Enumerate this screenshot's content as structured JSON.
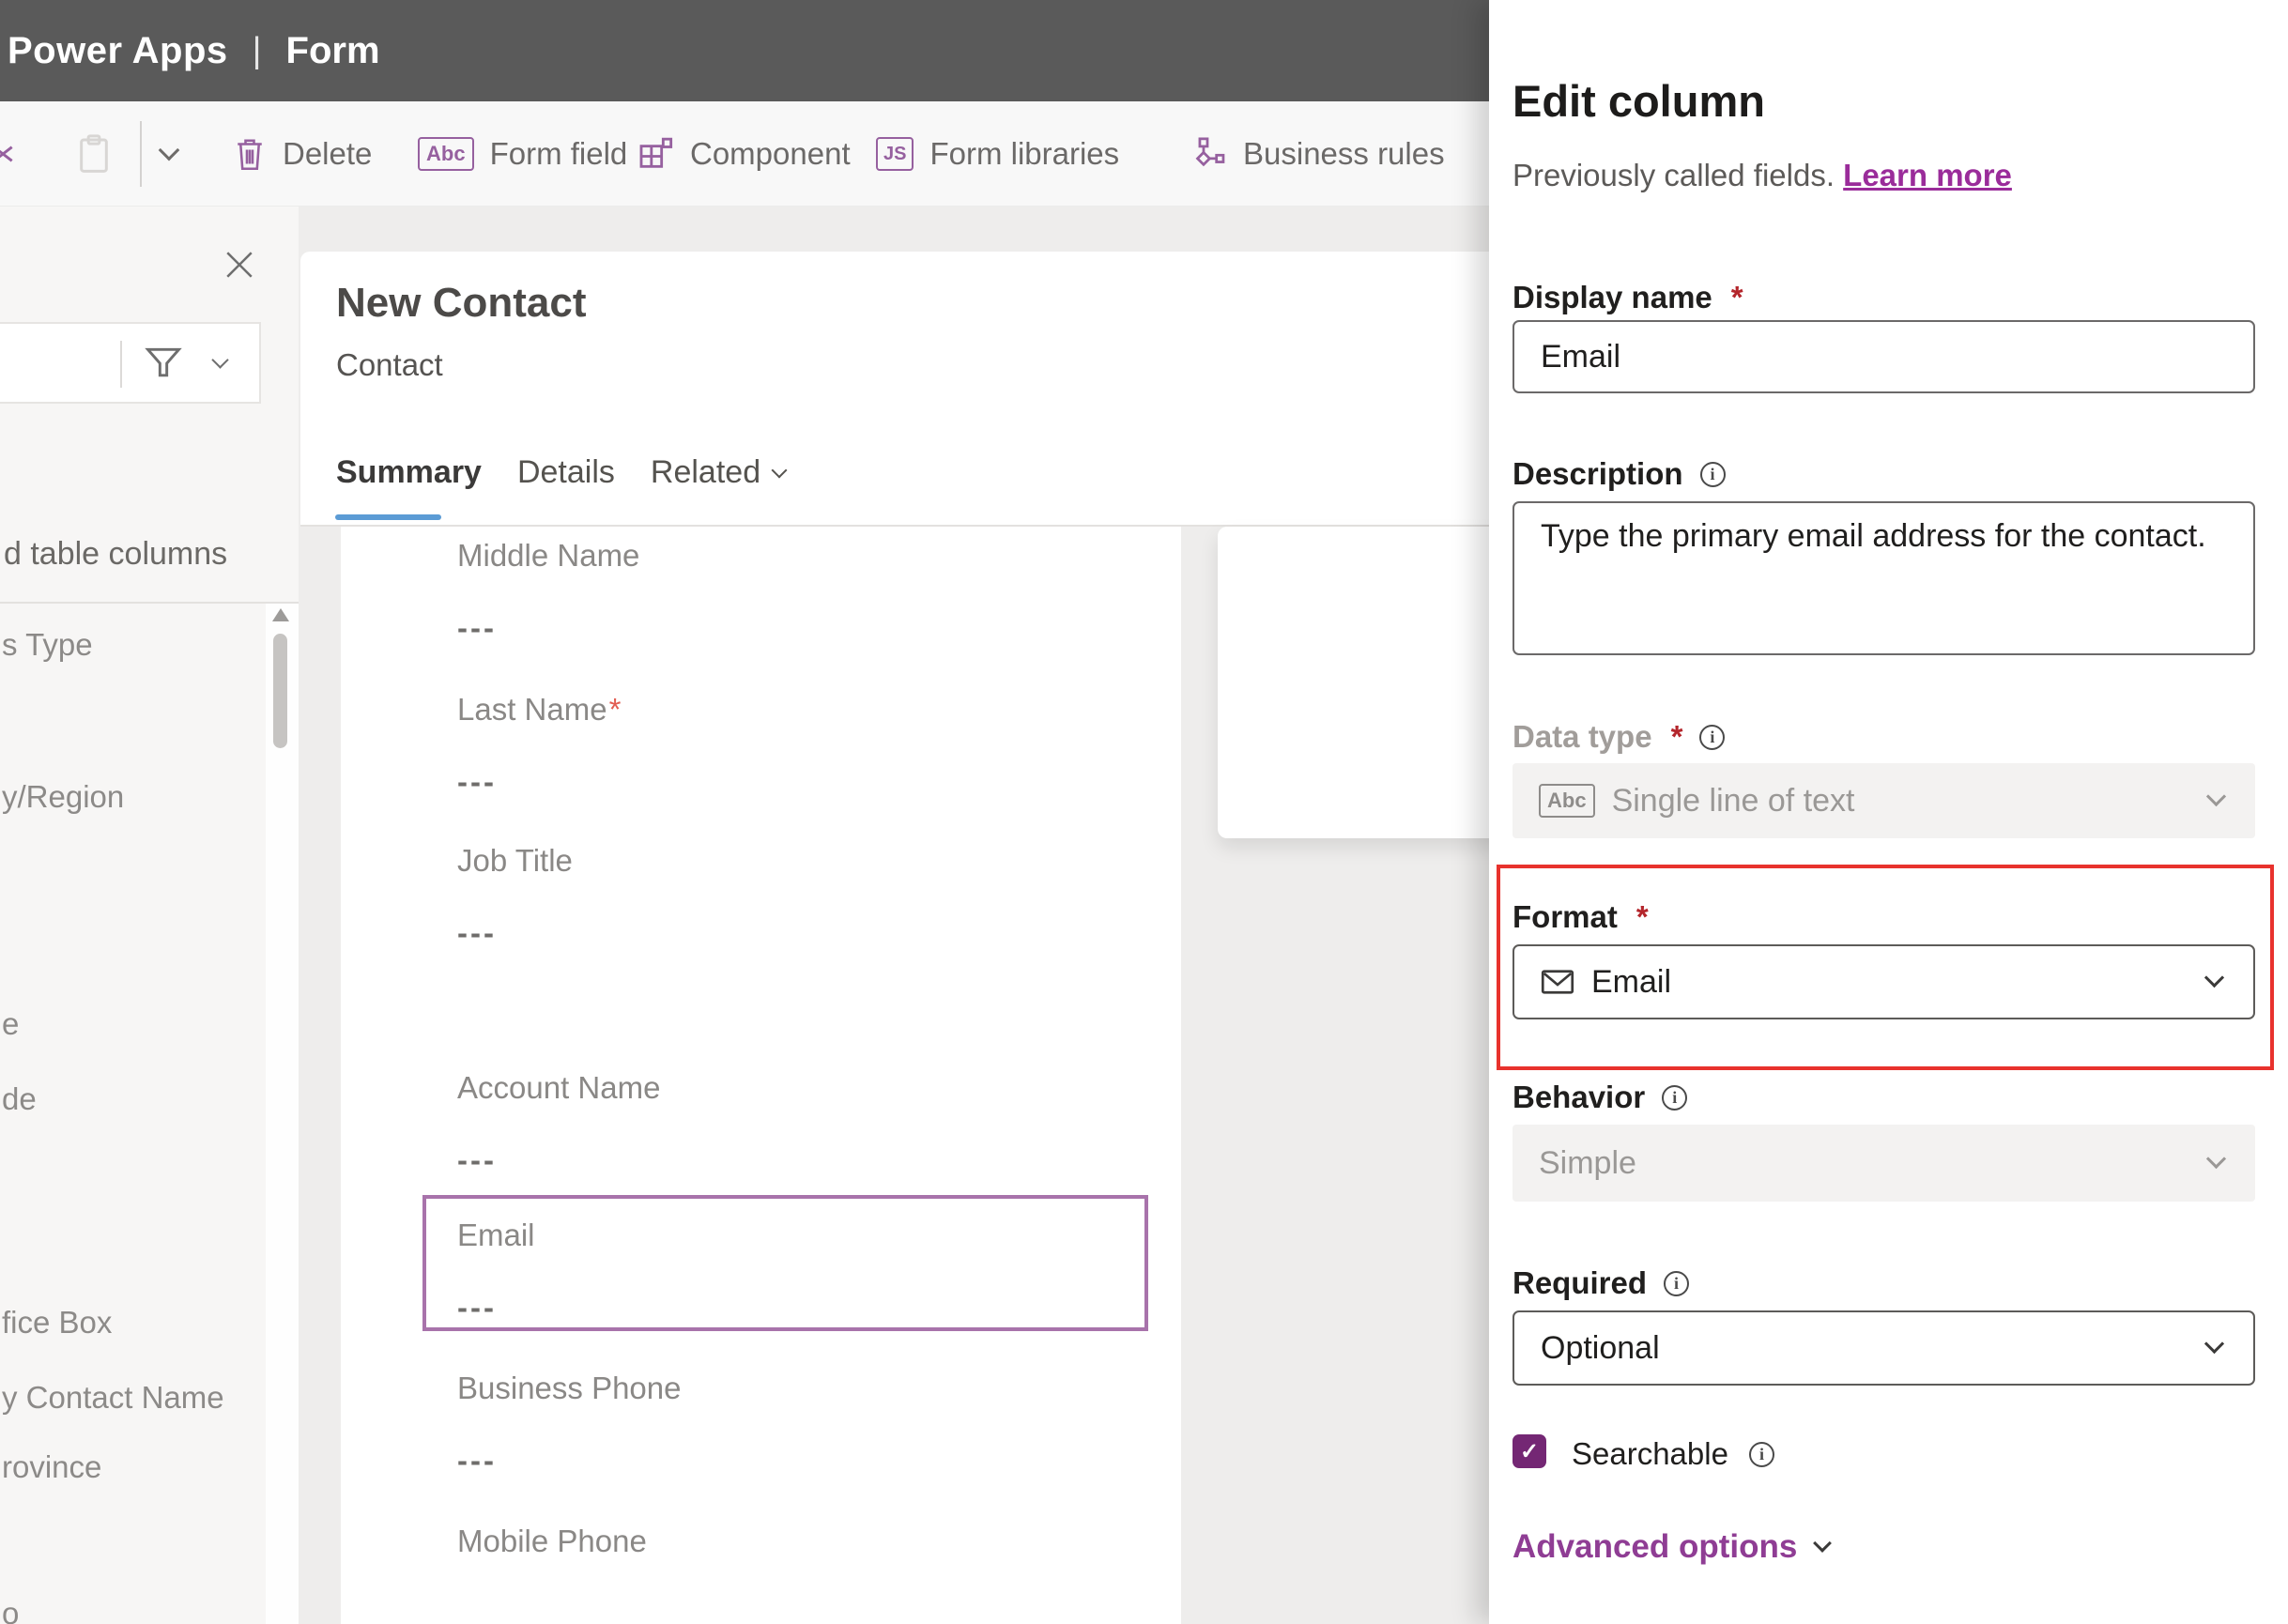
{
  "topbar": {
    "brand": "Power Apps",
    "separator": "|",
    "page": "Form"
  },
  "toolbar": {
    "items": [
      {
        "name": "delete",
        "label": "Delete"
      },
      {
        "name": "form-field",
        "label": "Form field",
        "icon_text": "Abc"
      },
      {
        "name": "component",
        "label": "Component"
      },
      {
        "name": "form-libraries",
        "label": "Form libraries",
        "icon_text": "JS"
      },
      {
        "name": "business-rules",
        "label": "Business rules"
      }
    ]
  },
  "sidebar": {
    "heading": "d table columns",
    "items": [
      "s Type",
      "y/Region",
      "e",
      "de",
      "fice Box",
      "y Contact Name",
      "rovince",
      "o"
    ]
  },
  "form": {
    "title": "New Contact",
    "entity": "Contact",
    "tabs": [
      {
        "label": "Summary",
        "active": true
      },
      {
        "label": "Details",
        "active": false
      },
      {
        "label": "Related",
        "active": false,
        "has_chevron": true
      }
    ],
    "fields": [
      {
        "label": "Middle Name",
        "value": "---"
      },
      {
        "label": "Last Name",
        "required_mark": "*",
        "value": "---"
      },
      {
        "label": "Job Title",
        "value": "---"
      },
      {
        "label": "Account Name",
        "value": "---"
      },
      {
        "label": "Email",
        "value": "---",
        "selected": true
      },
      {
        "label": "Business Phone",
        "value": "---"
      },
      {
        "label": "Mobile Phone",
        "value": ""
      }
    ]
  },
  "panel": {
    "title": "Edit column",
    "subtitle": "Previously called fields.",
    "learn_more": "Learn more",
    "display_name": {
      "label": "Display name",
      "required_mark": "*",
      "value": "Email"
    },
    "description": {
      "label": "Description",
      "value": "Type the primary email address for the contact."
    },
    "data_type": {
      "label": "Data type",
      "required_mark": "*",
      "value": "Single line of text",
      "icon_text": "Abc",
      "disabled": true
    },
    "format": {
      "label": "Format",
      "required_mark": "*",
      "value": "Email",
      "highlighted": true
    },
    "behavior": {
      "label": "Behavior",
      "value": "Simple",
      "disabled": true
    },
    "required": {
      "label": "Required",
      "value": "Optional"
    },
    "searchable": {
      "label": "Searchable",
      "checked": true,
      "check_glyph": "✓"
    },
    "advanced_options": {
      "label": "Advanced options"
    }
  },
  "colors": {
    "topbar_gray": "#5a5a5a",
    "toolbar_icon_purple": "#96609f",
    "selection_purple": "#a873ab",
    "annotation_red": "#e8322d",
    "link_purple": "#9a2c9a",
    "checkbox_purple": "#742774",
    "tab_underline_blue": "#5b9bd5",
    "required_red": "#b4262c"
  }
}
